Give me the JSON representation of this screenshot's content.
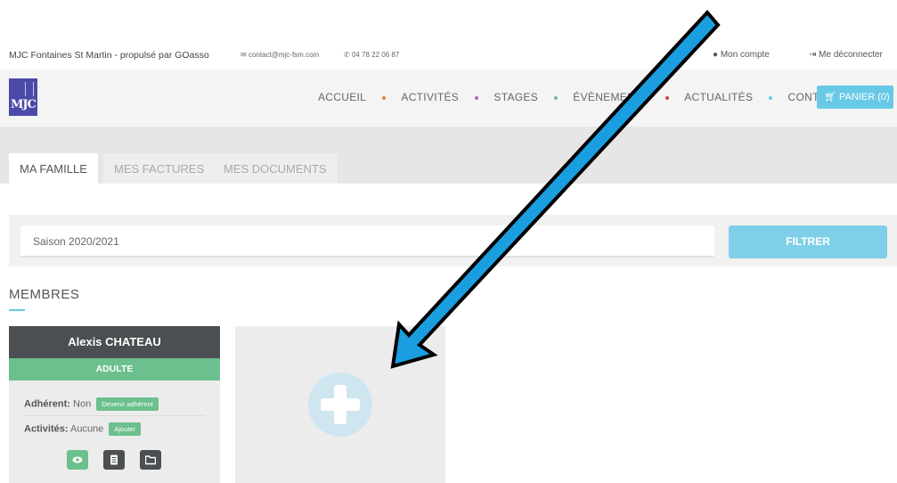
{
  "topbar": {
    "site_name": "MJC Fontaines St Martin - propulsé par GOasso",
    "email": "contact@mjc-fsm.com",
    "phone": "04 78 22 06 87",
    "account": "Mon compte",
    "logout": "Me déconnecter"
  },
  "logo": {
    "text": "MJC"
  },
  "nav": {
    "items": [
      "ACCUEIL",
      "ACTIVITÉS",
      "STAGES",
      "ÉVÈNEMENTS",
      "ACTUALITÉS",
      "CONTACT"
    ],
    "dot_colors": [
      "#e8833a",
      "#a66bb8",
      "#6cc08e",
      "#c94a4a",
      "#67c9e6"
    ],
    "cart": "PANIER (0)"
  },
  "tabs": [
    {
      "label": "MA FAMILLE",
      "active": true
    },
    {
      "label": "MES FACTURES",
      "active": false
    },
    {
      "label": "MES DOCUMENTS",
      "active": false
    }
  ],
  "filter": {
    "season": "Saison 2020/2021",
    "button": "FILTRER"
  },
  "members": {
    "title": "MEMBRES",
    "card": {
      "name": "Alexis CHATEAU",
      "role": "ADULTE",
      "adherent_label": "Adhérent:",
      "adherent_value": "Non",
      "adherent_action": "Devenir adhérent",
      "activities_label": "Activités:",
      "activities_value": "Aucune",
      "activities_action": "Ajouter"
    }
  },
  "colors": {
    "accent": "#67c9e6",
    "green": "#6cc08e",
    "dark": "#4b4f51",
    "arrow": "#1a9ee0"
  }
}
